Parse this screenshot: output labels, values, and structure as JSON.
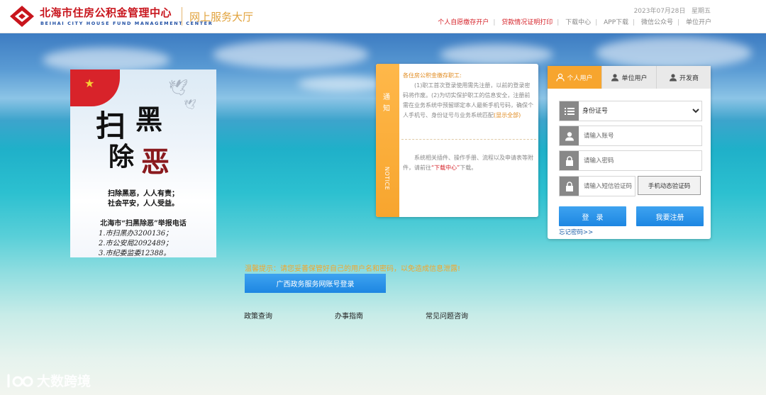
{
  "header": {
    "logo_cn": "北海市住房公积金管理中心",
    "logo_en": "BEIHAI CITY  HOUSE FUND  MANAGEMENT  CENTER",
    "subtitle": "网上服务大厅",
    "date": "2023年07月28日",
    "weekday": "星期五",
    "nav": [
      {
        "label": "个人自愿缴存开户",
        "color": "red"
      },
      {
        "label": "贷款情况证明打印",
        "color": "red"
      },
      {
        "label": "下载中心",
        "color": "gray"
      },
      {
        "label": "APP下载",
        "color": "gray"
      },
      {
        "label": "微信公众号",
        "color": "gray"
      },
      {
        "label": "单位开户",
        "color": "gray"
      }
    ]
  },
  "poster": {
    "char1": "扫",
    "char2": "黑",
    "char3": "除",
    "char4": "恶",
    "slogan1": "扫除黑恶，人人有责；",
    "slogan2": "社会平安，人人受益。",
    "hotline": "北海市“扫黑除恶”举报电话",
    "items": [
      "1.市扫黑办3200136；",
      "2.市公安局2092489；",
      "3.市纪委监委12388。"
    ]
  },
  "notice": {
    "tab_cn": "通知",
    "tab_en": "NOTICE",
    "title": "各住房公积金缴存职工:",
    "p1": "(1)职工首次登录使用需先注册，以前的登录密码将作废。(2)为切实保护职工的信息安全，注册前需在业务系统中预留绑定本人最新手机号码，确保个人手机号、身份证号与业务系统匹配",
    "show_all": "(显示全部)",
    "p2_before": "系统相关插件、操作手册、流程以及申请表等附件，请前往",
    "p2_link": "“下载中心”",
    "p2_after": "下载。"
  },
  "login": {
    "tabs": [
      "个人用户",
      "单位用户",
      "开发商"
    ],
    "id_type": "身份证号",
    "id_options": [
      "身份证号"
    ],
    "account_placeholder": "请输入账号",
    "password_placeholder": "请输入密码",
    "sms_placeholder": "请输入短信验证码",
    "sms_button": "手机动态验证码",
    "login_button": "登　录",
    "register_button": "我要注册",
    "forgot": "忘记密码>>"
  },
  "center": {
    "warm_tip": "温馨提示：请您妥善保管好自己的用户名和密码，以免造成信息泄露!",
    "gx_login": "广西政务服务网账号登录",
    "links": [
      "政策查询",
      "办事指南",
      "常见问题咨询"
    ]
  },
  "watermark": "大数跨境",
  "colors": {
    "brand_red": "#c8151d",
    "accent_orange": "#f7a52e",
    "button_blue": "#1d86e2",
    "logo_blue": "#1f4ea3"
  }
}
